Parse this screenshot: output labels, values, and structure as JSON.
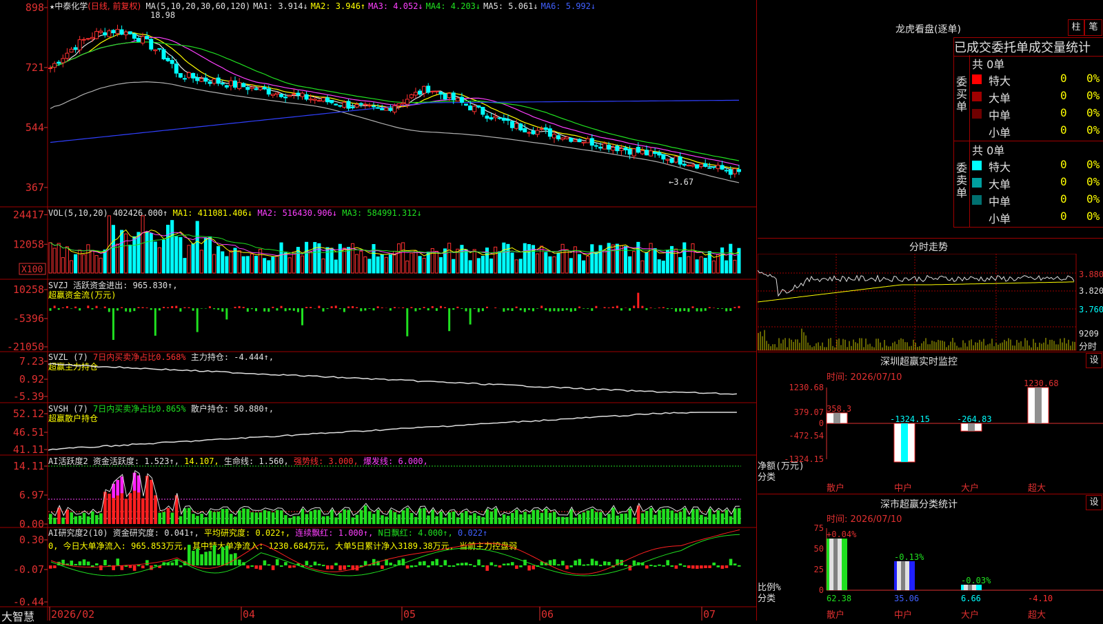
{
  "stock": {
    "star": "★",
    "name": "中泰化学",
    "period": "(日线, 前复权)",
    "high_mark": "18.98",
    "low_mark": "←3.67"
  },
  "ma_header": [
    {
      "t": "MA(5,10,20,30,60,120)",
      "c": "#e0e0e0"
    },
    {
      "t": "MA1: 3.914↓",
      "c": "#e0e0e0"
    },
    {
      "t": "MA2: 3.946↑",
      "c": "#ffff00"
    },
    {
      "t": "MA3: 4.052↓",
      "c": "#ff40ff"
    },
    {
      "t": "MA4: 4.203↓",
      "c": "#20e020"
    },
    {
      "t": "MA5: 5.061↓",
      "c": "#e0e0e0"
    },
    {
      "t": "MA6: 5.992↓",
      "c": "#4060ff"
    }
  ],
  "price_axis": [
    "898",
    "721",
    "544",
    "367"
  ],
  "vol_header": [
    {
      "t": "VOL(5,10,20)",
      "c": "#e0e0e0"
    },
    {
      "t": "402426.000↑",
      "c": "#e0e0e0"
    },
    {
      "t": "MA1: 411081.406↓",
      "c": "#ffff00"
    },
    {
      "t": "MA2: 516430.906↓",
      "c": "#ff40ff"
    },
    {
      "t": "MA3: 584991.312↓",
      "c": "#20e020"
    }
  ],
  "vol_axis": [
    "24417",
    "12058"
  ],
  "vol_unit": "X100",
  "svzj": {
    "line1": "SVZJ  活跃资金进出: 965.830↑,",
    "line2": "超赢资金流(万元)",
    "axis": [
      "10258",
      "-5396",
      "-21050"
    ]
  },
  "svzl": {
    "a": "SVZL (7)",
    "b": "7日内买卖净占比0.568%",
    "c": "主力持仓: -4.444↑,",
    "line2": "超赢主力持仓",
    "axis": [
      "7.23",
      "0.92",
      "-5.39"
    ]
  },
  "svsh": {
    "a": "SVSH (7)",
    "b": "7日内买卖净占比0.865%",
    "c": "散户持仓: 50.880↑,",
    "line2": "超赢散户持仓",
    "axis": [
      "52.12",
      "46.51",
      "41.11"
    ]
  },
  "ai1": {
    "parts": [
      {
        "t": "AI活跃度2 资金活跃度: 1.523↑,",
        "c": "#e0e0e0"
      },
      {
        "t": "14.107,",
        "c": "#ffff00"
      },
      {
        "t": "生命线: 1.560,",
        "c": "#e0e0e0"
      },
      {
        "t": "强势线: 3.000,",
        "c": "#ff3030"
      },
      {
        "t": "爆发线: 6.000,",
        "c": "#ff40ff"
      }
    ],
    "axis": [
      "14.11",
      "6.97",
      "0.00"
    ]
  },
  "ai2": {
    "parts": [
      {
        "t": "AI研究度2(10) 资金研究度: 0.041↑,",
        "c": "#e0e0e0"
      },
      {
        "t": "平均研究度: 0.022↑,",
        "c": "#ffff00"
      },
      {
        "t": "连续飘红: 1.000↑,",
        "c": "#ff40ff"
      },
      {
        "t": "N日飘红: 4.000↑,",
        "c": "#20e020"
      },
      {
        "t": "0.022↑",
        "c": "#4060ff"
      }
    ],
    "line2": "0, 今日大单净流入: 965.853万元, 其中特大单净流入: 1230.684万元, 大单5日累计净入3189.38万元, 当前主力控盘弱",
    "axis": [
      "0.30",
      "-0.07",
      "-0.44"
    ]
  },
  "date_axis": [
    "2026/02",
    "04",
    "05",
    "06",
    "07"
  ],
  "brand": "大智慧",
  "right": {
    "title": "龙虎看盘(逐单)",
    "btn1": "柱",
    "btn2": "笔",
    "subtitle": "已成交委托单成交量统计",
    "buy_label": "委买单",
    "sell_label": "委卖单",
    "buy_total": "共 0单",
    "sell_total": "共 0单",
    "buy_rows": [
      {
        "n": "特大",
        "v": "0",
        "p": "0%",
        "c": "#ff0000"
      },
      {
        "n": "大单",
        "v": "0",
        "p": "0%",
        "c": "#a00000"
      },
      {
        "n": "中单",
        "v": "0",
        "p": "0%",
        "c": "#700000"
      },
      {
        "n": "小单",
        "v": "0",
        "p": "0%",
        "c": ""
      }
    ],
    "sell_rows": [
      {
        "n": "特大",
        "v": "0",
        "p": "0%",
        "c": "#00ffff"
      },
      {
        "n": "大单",
        "v": "0",
        "p": "0%",
        "c": "#00a0a0"
      },
      {
        "n": "中单",
        "v": "0",
        "p": "0%",
        "c": "#007070"
      },
      {
        "n": "小单",
        "v": "0",
        "p": "0%",
        "c": ""
      }
    ],
    "intraday_title": "分时走势",
    "intraday_axis": [
      "3.880",
      "3.820",
      "3.760"
    ],
    "intraday_vol": "9209",
    "intraday_tag": "分时",
    "sz_title": "深圳超赢实时监控",
    "sz_set": "设",
    "sz_date": "时间: 2026/07/10",
    "sz_axis": [
      "1230.68",
      "379.07",
      "0",
      "-472.54",
      "-1324.15"
    ],
    "sz_ylabel": "净额(万元)",
    "sz_xlabel": "分类",
    "sz_cats": [
      "散户",
      "中户",
      "大户",
      "超大"
    ],
    "sz_vals": [
      "358.3",
      "-1324.15",
      "-264.83",
      "1230.68"
    ],
    "cls_title": "深市超赢分类统计",
    "cls_set": "设",
    "cls_date": "时间: 2026/07/10",
    "cls_axis": [
      "75",
      "50",
      "25",
      "0"
    ],
    "cls_ylabel": "比例%",
    "cls_xlabel": "分类",
    "cls_cats": [
      "散户",
      "中户",
      "大户",
      "超大"
    ],
    "cls_top": [
      "+0.04%",
      "-0.13%",
      "-0.03%",
      ""
    ],
    "cls_bottom": [
      "62.38",
      "35.06",
      "6.66",
      "-4.10"
    ]
  },
  "chart_data": [
    {
      "type": "candlestick",
      "title": "中泰化学 (日线, 前复权)",
      "yticks": [
        898,
        721,
        544,
        367
      ],
      "annotations": [
        "18.98",
        "←3.67"
      ],
      "series": [
        "MA1",
        "MA2",
        "MA3",
        "MA4",
        "MA5",
        "MA6"
      ]
    },
    {
      "type": "bar",
      "title": "VOL(5,10,20)",
      "yticks": [
        24417,
        12058
      ],
      "unit": "X100"
    },
    {
      "type": "bar",
      "title": "超赢资金流(万元)",
      "yticks": [
        10258,
        -5396,
        -21050
      ]
    },
    {
      "type": "line",
      "title": "超赢主力持仓",
      "yticks": [
        7.23,
        0.92,
        -5.39
      ]
    },
    {
      "type": "line",
      "title": "超赢散户持仓",
      "yticks": [
        52.12,
        46.51,
        41.11
      ]
    },
    {
      "type": "bar",
      "title": "AI活跃度2",
      "yticks": [
        14.11,
        6.97,
        0.0
      ]
    },
    {
      "type": "bar",
      "title": "AI研究度2(10)",
      "yticks": [
        0.3,
        -0.07,
        -0.44
      ]
    },
    {
      "type": "bar",
      "title": "深圳超赢实时监控",
      "categories": [
        "散户",
        "中户",
        "大户",
        "超大"
      ],
      "values": [
        358.3,
        -1324.15,
        -264.83,
        1230.68
      ],
      "ylabel": "净额(万元)",
      "xlabel": "分类",
      "yticks": [
        1230.68,
        379.07,
        0,
        -472.54,
        -1324.15
      ]
    },
    {
      "type": "bar",
      "title": "深市超赢分类统计",
      "categories": [
        "散户",
        "中户",
        "大户",
        "超大"
      ],
      "values": [
        62.38,
        35.06,
        6.66,
        -4.1
      ],
      "changes": [
        "+0.04%",
        "-0.13%",
        "-0.03%",
        ""
      ],
      "ylabel": "比例%",
      "xlabel": "分类",
      "yticks": [
        75,
        50,
        25,
        0
      ]
    }
  ]
}
